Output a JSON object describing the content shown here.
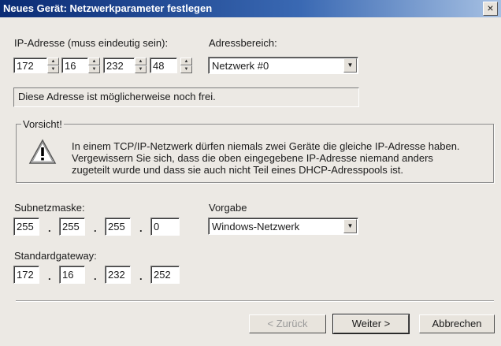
{
  "window": {
    "title": "Neues Gerät: Netzwerkparameter festlegen",
    "close_glyph": "×"
  },
  "ip": {
    "label": "IP-Adresse (muss eindeutig sein):",
    "octets": [
      "172",
      "16",
      "232",
      "48"
    ]
  },
  "range": {
    "label": "Adressbereich:",
    "value": "Netzwerk #0"
  },
  "status": {
    "text": "Diese Adresse ist möglicherweise noch frei."
  },
  "warning": {
    "group_label": "Vorsicht!",
    "icon": "warning-icon",
    "lines": [
      "In einem TCP/IP-Netzwerk dürfen niemals zwei Geräte die gleiche IP-Adresse haben.",
      "Vergewissern Sie sich, dass die oben eingegebene IP-Adresse niemand anders",
      "zugeteilt wurde und dass sie auch nicht Teil eines DHCP-Adresspools ist."
    ]
  },
  "subnet": {
    "label": "Subnetzmaske:",
    "octets": [
      "255",
      "255",
      "255",
      "0"
    ]
  },
  "preset": {
    "label": "Vorgabe",
    "value": "Windows-Netzwerk"
  },
  "gateway": {
    "label": "Standardgateway:",
    "octets": [
      "172",
      "16",
      "232",
      "252"
    ]
  },
  "ip_separator": ".",
  "buttons": {
    "back": "< Zurück",
    "next": "Weiter >",
    "cancel": "Abbrechen"
  }
}
